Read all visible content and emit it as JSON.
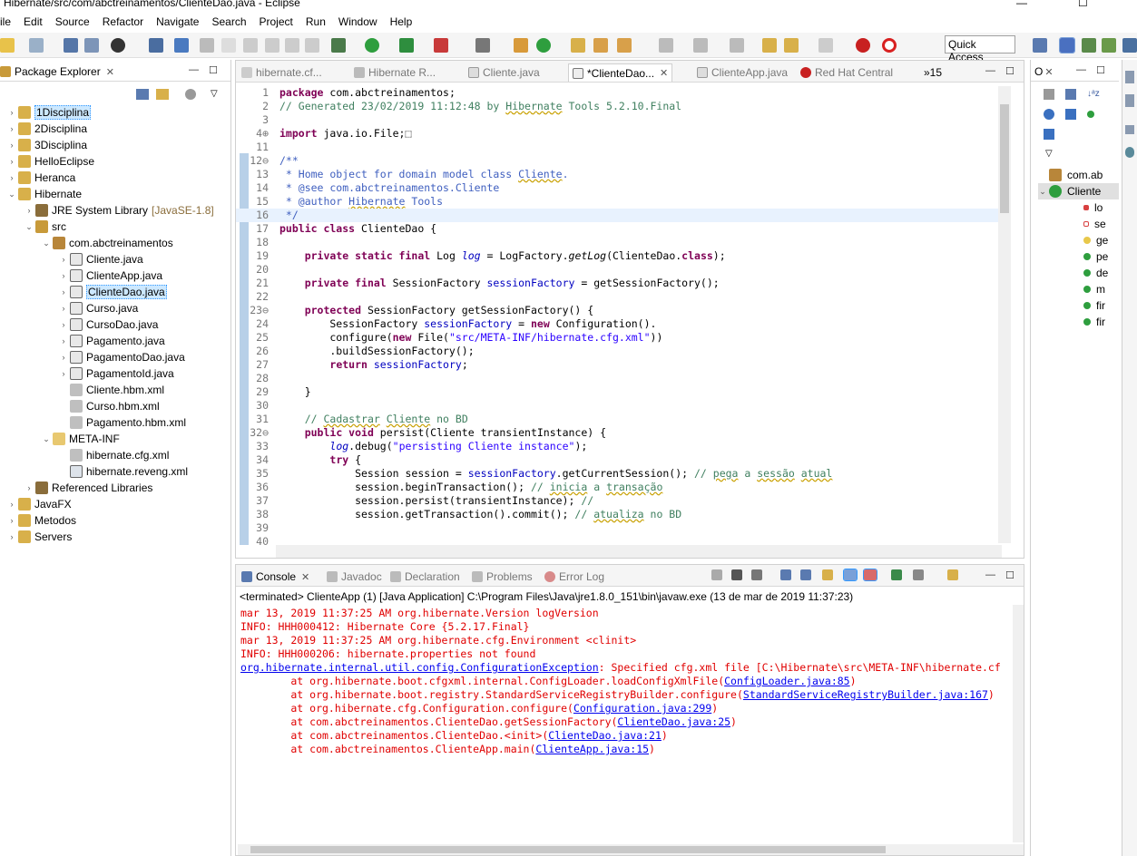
{
  "window": {
    "title": "Hibernate/src/com/abctreinamentos/ClienteDao.java - Eclipse",
    "min": "—",
    "max": "☐"
  },
  "menu": [
    "ile",
    "Edit",
    "Source",
    "Refactor",
    "Navigate",
    "Search",
    "Project",
    "Run",
    "Window",
    "Help"
  ],
  "toolbar": {
    "quick_access": "Quick Access"
  },
  "package_explorer": {
    "tab_label": "Package Explorer",
    "items": [
      {
        "label": "1Disciplina",
        "depth": 0,
        "arrow": "›",
        "icon": "project",
        "selected": true
      },
      {
        "label": "2Disciplina",
        "depth": 0,
        "arrow": "›",
        "icon": "project"
      },
      {
        "label": "3Disciplina",
        "depth": 0,
        "arrow": "›",
        "icon": "project"
      },
      {
        "label": "HelloEclipse",
        "depth": 0,
        "arrow": "›",
        "icon": "project"
      },
      {
        "label": "Heranca",
        "depth": 0,
        "arrow": "›",
        "icon": "project"
      },
      {
        "label": "Hibernate",
        "depth": 0,
        "arrow": "⌄",
        "icon": "project"
      },
      {
        "label": "JRE System Library",
        "decor": "[JavaSE-1.8]",
        "depth": 1,
        "arrow": "›",
        "icon": "library"
      },
      {
        "label": "src",
        "depth": 1,
        "arrow": "⌄",
        "icon": "srcfolder"
      },
      {
        "label": "com.abctreinamentos",
        "depth": 2,
        "arrow": "⌄",
        "icon": "package"
      },
      {
        "label": "Cliente.java",
        "depth": 3,
        "arrow": "›",
        "icon": "java"
      },
      {
        "label": "ClienteApp.java",
        "depth": 3,
        "arrow": "›",
        "icon": "java"
      },
      {
        "label": "ClienteDao.java",
        "depth": 3,
        "arrow": "›",
        "icon": "java",
        "selected": true
      },
      {
        "label": "Curso.java",
        "depth": 3,
        "arrow": "›",
        "icon": "java"
      },
      {
        "label": "CursoDao.java",
        "depth": 3,
        "arrow": "›",
        "icon": "java"
      },
      {
        "label": "Pagamento.java",
        "depth": 3,
        "arrow": "›",
        "icon": "java"
      },
      {
        "label": "PagamentoDao.java",
        "depth": 3,
        "arrow": "›",
        "icon": "java"
      },
      {
        "label": "PagamentoId.java",
        "depth": 3,
        "arrow": "›",
        "icon": "java"
      },
      {
        "label": "Cliente.hbm.xml",
        "depth": 3,
        "arrow": "",
        "icon": "xml"
      },
      {
        "label": "Curso.hbm.xml",
        "depth": 3,
        "arrow": "",
        "icon": "xml"
      },
      {
        "label": "Pagamento.hbm.xml",
        "depth": 3,
        "arrow": "",
        "icon": "xml"
      },
      {
        "label": "META-INF",
        "depth": 2,
        "arrow": "⌄",
        "icon": "folder"
      },
      {
        "label": "hibernate.cfg.xml",
        "depth": 3,
        "arrow": "",
        "icon": "xml"
      },
      {
        "label": "hibernate.reveng.xml",
        "depth": 3,
        "arrow": "",
        "icon": "xmlx"
      },
      {
        "label": "Referenced Libraries",
        "depth": 1,
        "arrow": "›",
        "icon": "library"
      },
      {
        "label": "JavaFX",
        "depth": 0,
        "arrow": "›",
        "icon": "project"
      },
      {
        "label": "Metodos",
        "depth": 0,
        "arrow": "›",
        "icon": "project"
      },
      {
        "label": "Servers",
        "depth": 0,
        "arrow": "›",
        "icon": "project"
      }
    ]
  },
  "editor": {
    "tabs": [
      {
        "label": "hibernate.cf...",
        "active": false
      },
      {
        "label": "Hibernate R...",
        "active": false
      },
      {
        "label": "Cliente.java",
        "active": false
      },
      {
        "label": "*ClienteDao...",
        "active": true
      },
      {
        "label": "ClienteApp.java",
        "active": false
      },
      {
        "label": "Red Hat Central",
        "active": false
      },
      {
        "label": "»15",
        "active": false
      }
    ],
    "lines": [
      {
        "n": "1",
        "html": "<span class='kw'>package</span> com.abctreinamentos;"
      },
      {
        "n": "2",
        "html": "<span class='cm'>// Generated 23/02/2019 11:12:48 by <span class='sq'>Hibernate</span> Tools 5.2.10.Final</span>"
      },
      {
        "n": "3",
        "html": ""
      },
      {
        "n": "4⊕",
        "html": "<span class='kw'>import</span> java.io.File;⬚"
      },
      {
        "n": "11",
        "html": ""
      },
      {
        "n": "12⊖",
        "html": "<span class='jd'>/**</span>"
      },
      {
        "n": "13",
        "html": "<span class='jd'> * Home object for domain model class <span class='sq'>Cliente</span>.</span>"
      },
      {
        "n": "14",
        "html": "<span class='jd'> * @see com.abctreinamentos.Cliente</span>"
      },
      {
        "n": "15",
        "html": "<span class='jd'> * @author <span class='sq'>Hibernate</span> Tools</span>"
      },
      {
        "n": "16",
        "html": "<span class='jd'> */</span>",
        "hl": true
      },
      {
        "n": "17",
        "html": "<span class='kw'>public class</span> ClienteDao {"
      },
      {
        "n": "18",
        "html": ""
      },
      {
        "n": "19",
        "html": "    <span class='kw'>private static final</span> Log <span class='fld ital'>log</span> = LogFactory.<span class='ital'>getLog</span>(ClienteDao.<span class='kw'>class</span>);"
      },
      {
        "n": "20",
        "html": ""
      },
      {
        "n": "21",
        "html": "    <span class='kw'>private final</span> SessionFactory <span class='fld'>sessionFactory</span> = getSessionFactory();"
      },
      {
        "n": "22",
        "html": ""
      },
      {
        "n": "23⊖",
        "html": "    <span class='kw'>protected</span> SessionFactory getSessionFactory() {"
      },
      {
        "n": "24",
        "html": "        SessionFactory <span class='fld'>sessionFactory</span> = <span class='kw'>new</span> Configuration()."
      },
      {
        "n": "25",
        "html": "        configure(<span class='kw'>new</span> File(<span class='str'>\"src/META-INF/hibernate.cfg.xml\"</span>))"
      },
      {
        "n": "26",
        "html": "        .buildSessionFactory();"
      },
      {
        "n": "27",
        "html": "        <span class='kw'>return</span> <span class='fld'>sessionFactory</span>;"
      },
      {
        "n": "28",
        "html": ""
      },
      {
        "n": "29",
        "html": "    }"
      },
      {
        "n": "30",
        "html": ""
      },
      {
        "n": "31",
        "html": "    <span class='cm'>// <span class='sq'>Cadastrar</span> <span class='sq'>Cliente</span> no BD</span>"
      },
      {
        "n": "32⊖",
        "html": "    <span class='kw'>public void</span> persist(Cliente transientInstance) {"
      },
      {
        "n": "33",
        "html": "        <span class='fld ital'>log</span>.debug(<span class='str'>\"persisting Cliente instance\"</span>);"
      },
      {
        "n": "34",
        "html": "        <span class='kw'>try</span> {"
      },
      {
        "n": "35",
        "html": "            Session session = <span class='fld'>sessionFactory</span>.getCurrentSession(); <span class='cm'>// <span class='sq'>pega</span> a <span class='sq'>sessão</span> <span class='sq'>atual</span></span>"
      },
      {
        "n": "36",
        "html": "            session.beginTransaction(); <span class='cm'>// <span class='sq'>inicia</span> a <span class='sq'>transação</span></span>"
      },
      {
        "n": "37",
        "html": "            session.persist(transientInstance); <span class='cm'>//</span>"
      },
      {
        "n": "38",
        "html": "            session.getTransaction().commit(); <span class='cm'>// <span class='sq'>atualiza</span> no BD</span>"
      },
      {
        "n": "39",
        "html": ""
      },
      {
        "n": "40",
        "html": ""
      }
    ]
  },
  "console": {
    "tabs": [
      {
        "label": "Console",
        "active": true
      },
      {
        "label": "Javadoc",
        "active": false
      },
      {
        "label": "Declaration",
        "active": false
      },
      {
        "label": "Problems",
        "active": false
      },
      {
        "label": "Error Log",
        "active": false
      }
    ],
    "status": "<terminated> ClienteApp (1) [Java Application] C:\\Program Files\\Java\\jre1.8.0_151\\bin\\javaw.exe (13 de mar de 2019 11:37:23)",
    "lines": [
      {
        "html": "mar 13, 2019 11:37:25 AM org.hibernate.Version logVersion"
      },
      {
        "html": "INFO: HHH000412: Hibernate Core {5.2.17.Final}"
      },
      {
        "html": "mar 13, 2019 11:37:25 AM org.hibernate.cfg.Environment &lt;clinit&gt;"
      },
      {
        "html": "INFO: HHH000206: hibernate.properties not found"
      },
      {
        "html": "<span class='link'>org.hibernate.internal.util.config.ConfigurationException</span>: Specified cfg.xml file [C:\\Hibernate\\src\\META-INF\\hibernate.cf"
      },
      {
        "html": "        at org.hibernate.boot.cfgxml.internal.ConfigLoader.loadConfigXmlFile(<span class='link'>ConfigLoader.java:85</span>)"
      },
      {
        "html": "        at org.hibernate.boot.registry.StandardServiceRegistryBuilder.configure(<span class='link'>StandardServiceRegistryBuilder.java:167</span>)"
      },
      {
        "html": "        at org.hibernate.cfg.Configuration.configure(<span class='link'>Configuration.java:299</span>)"
      },
      {
        "html": "        at com.abctreinamentos.ClienteDao.getSessionFactory(<span class='link'>ClienteDao.java:25</span>)"
      },
      {
        "html": "        at com.abctreinamentos.ClienteDao.&lt;init&gt;(<span class='link'>ClienteDao.java:21</span>)"
      },
      {
        "html": "        at com.abctreinamentos.ClienteApp.main(<span class='link'>ClienteApp.java:15</span>)"
      }
    ]
  },
  "outline": {
    "tab_label": "O",
    "items": [
      {
        "label": "com.ab",
        "icon": "package"
      },
      {
        "label": "Cliente",
        "icon": "class",
        "selected": true
      },
      {
        "label": "lo",
        "icon": "field-sf"
      },
      {
        "label": "se",
        "icon": "field-f"
      },
      {
        "label": "ge",
        "icon": "method-protected"
      },
      {
        "label": "pe",
        "icon": "method-public"
      },
      {
        "label": "de",
        "icon": "method-public"
      },
      {
        "label": "m",
        "icon": "method-public"
      },
      {
        "label": "fir",
        "icon": "method-public"
      },
      {
        "label": "fir",
        "icon": "method-public"
      }
    ]
  },
  "colors": {
    "accent": "#3399ff",
    "keyword": "#7f0055",
    "comment": "#3f7f5f",
    "string": "#2a00ff",
    "error": "#e00000"
  }
}
